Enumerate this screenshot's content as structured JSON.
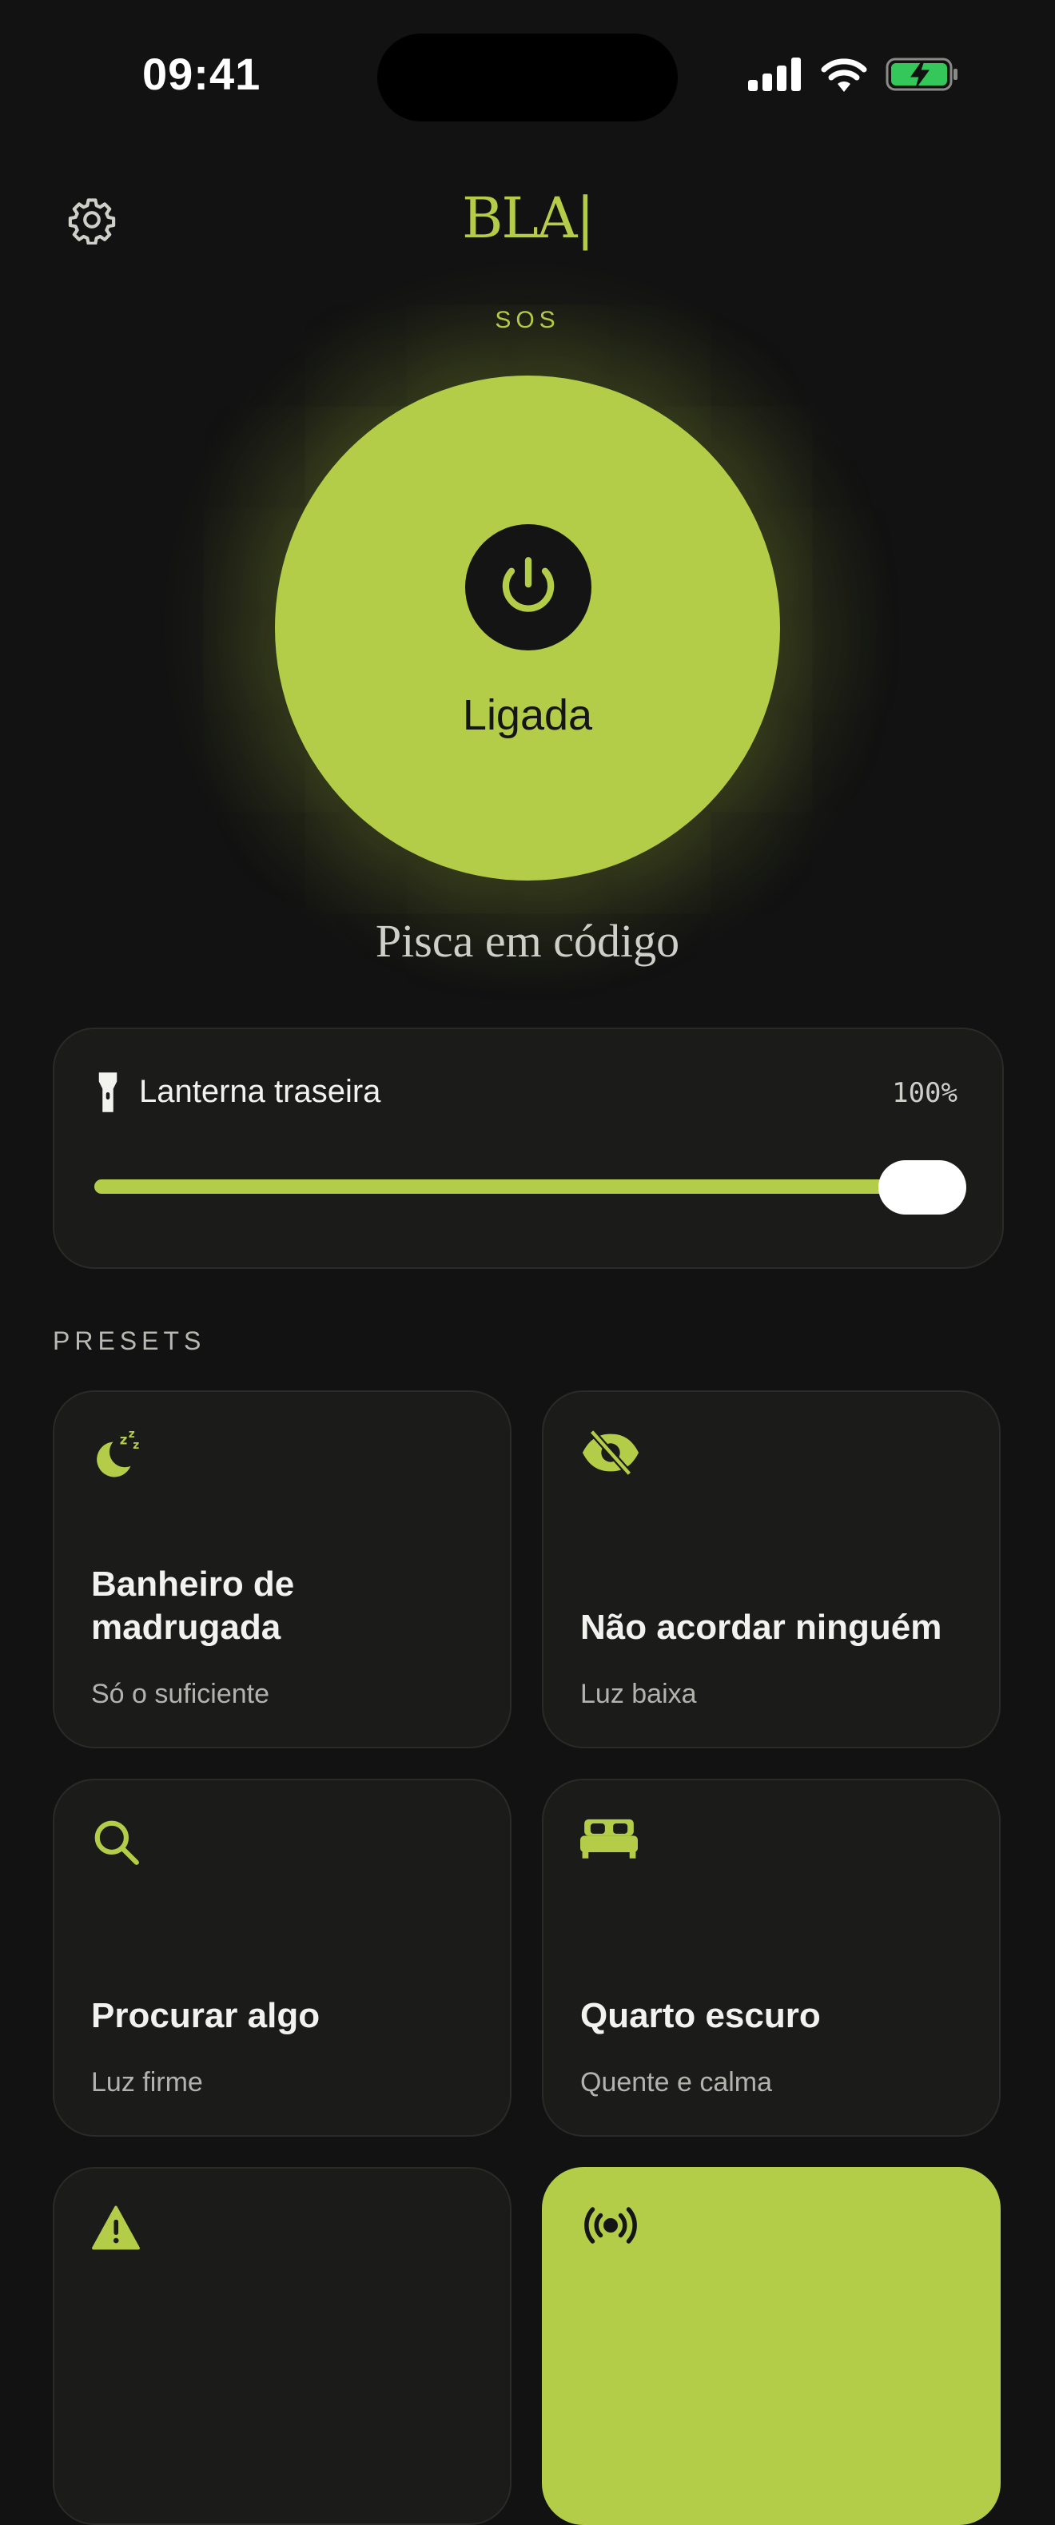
{
  "status_bar": {
    "time": "09:41"
  },
  "header": {
    "logo": "BLA|",
    "settings_icon": "gear-icon"
  },
  "sos_label": "SOS",
  "main_button": {
    "label": "Ligada",
    "icon": "power-icon"
  },
  "mode_label": "Pisca em código",
  "flashlight": {
    "title": "Lanterna traseira",
    "value_label": "100%",
    "level": 1.0,
    "icon": "flashlight-icon"
  },
  "presets_title": "PRESETS",
  "presets": [
    {
      "title": "Banheiro de madrugada",
      "subtitle": "Só o suficiente",
      "icon": "moon-sleep-icon"
    },
    {
      "title": "Não acordar ninguém",
      "subtitle": "Luz baixa",
      "icon": "eye-off-icon"
    },
    {
      "title": "Procurar algo",
      "subtitle": "Luz firme",
      "icon": "search-icon"
    },
    {
      "title": "Quarto escuro",
      "subtitle": "Quente e calma",
      "icon": "bed-icon"
    },
    {
      "title": "",
      "subtitle": "",
      "icon": "warning-icon"
    },
    {
      "title": "",
      "subtitle": "",
      "icon": "broadcast-icon",
      "active": true
    }
  ],
  "colors": {
    "accent": "#b4cd49",
    "background": "#121212",
    "card": "#1b1b1a"
  }
}
